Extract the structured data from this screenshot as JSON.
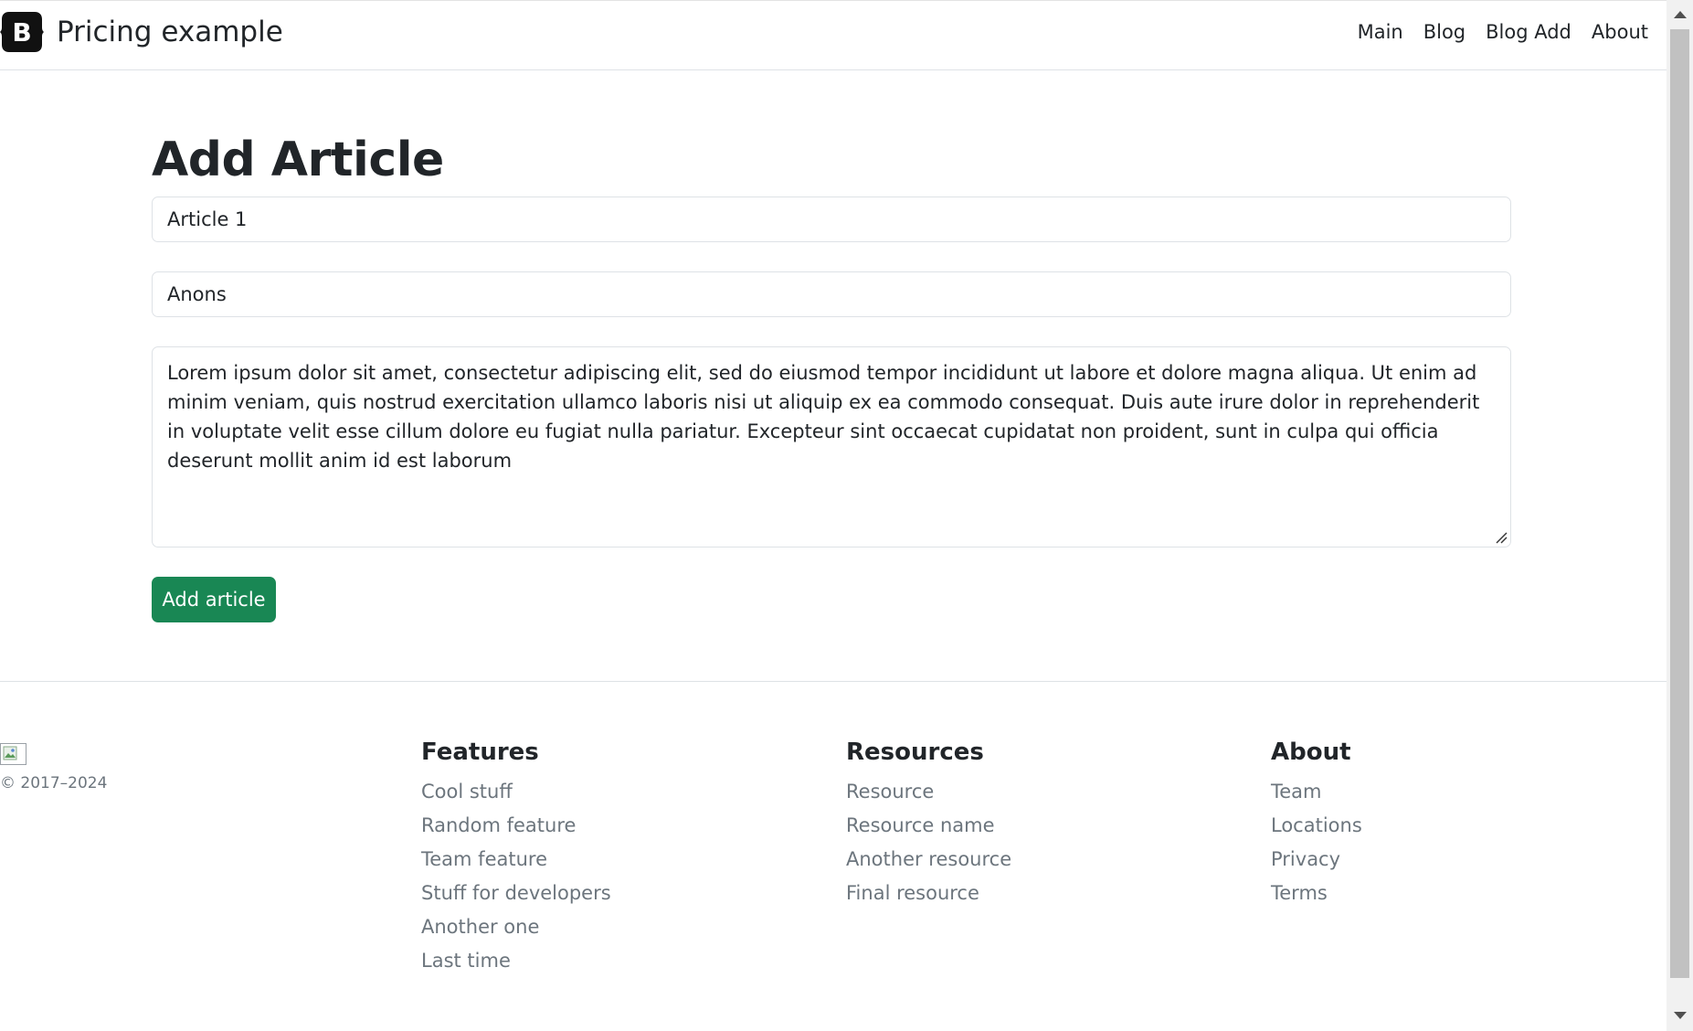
{
  "header": {
    "brand_letter": "B",
    "brand_title": "Pricing example",
    "nav": [
      {
        "label": "Main"
      },
      {
        "label": "Blog"
      },
      {
        "label": "Blog Add"
      },
      {
        "label": "About"
      }
    ]
  },
  "main": {
    "page_title": "Add Article",
    "title_value": "Article 1",
    "anons_value": "Anons",
    "full_text_value": "Lorem ipsum dolor sit amet, consectetur adipiscing elit, sed do eiusmod tempor incididunt ut labore et dolore magna aliqua. Ut enim ad minim veniam, quis nostrud exercitation ullamco laboris nisi ut aliquip ex ea commodo consequat. Duis aute irure dolor in reprehenderit in voluptate velit esse cillum dolore eu fugiat nulla pariatur. Excepteur sint occaecat cupidatat non proident, sunt in culpa qui officia deserunt mollit anim id est laborum",
    "submit_label": "Add article",
    "accent_color": "#198754"
  },
  "footer": {
    "copyright": "© 2017–2024",
    "columns": [
      {
        "heading": "Features",
        "items": [
          "Cool stuff",
          "Random feature",
          "Team feature",
          "Stuff for developers",
          "Another one",
          "Last time"
        ]
      },
      {
        "heading": "Resources",
        "items": [
          "Resource",
          "Resource name",
          "Another resource",
          "Final resource"
        ]
      },
      {
        "heading": "About",
        "items": [
          "Team",
          "Locations",
          "Privacy",
          "Terms"
        ]
      }
    ]
  }
}
